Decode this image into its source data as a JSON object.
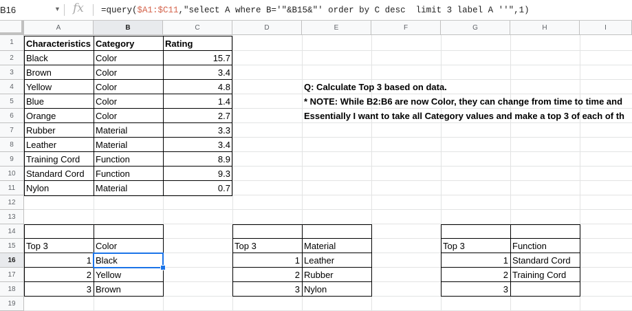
{
  "formula_bar": {
    "name_box": "B16",
    "fx": "fx",
    "formula_parts": [
      "=query(",
      "$A1:$C11",
      ",\"select A where B='\"&B15&\"' order by C desc  limit 3 label A ''\",1)"
    ]
  },
  "columns": [
    "A",
    "B",
    "C",
    "D",
    "E",
    "F",
    "G",
    "H",
    "I"
  ],
  "rows": [
    "1",
    "2",
    "3",
    "4",
    "5",
    "6",
    "7",
    "8",
    "9",
    "10",
    "11",
    "12",
    "13",
    "14",
    "15",
    "16",
    "17",
    "18",
    "19"
  ],
  "table": {
    "headers": [
      "Characteristics",
      "Category",
      "Rating"
    ],
    "rows": [
      [
        "Black",
        "Color",
        "15.7"
      ],
      [
        "Brown",
        "Color",
        "3.4"
      ],
      [
        "Yellow",
        "Color",
        "4.8"
      ],
      [
        "Blue",
        "Color",
        "1.4"
      ],
      [
        "Orange",
        "Color",
        "2.7"
      ],
      [
        "Rubber",
        "Material",
        "3.3"
      ],
      [
        "Leather",
        "Material",
        "3.4"
      ],
      [
        "Training Cord",
        "Function",
        "8.9"
      ],
      [
        "Standard Cord",
        "Function",
        "9.3"
      ],
      [
        "Nylon",
        "Material",
        "0.7"
      ]
    ]
  },
  "notes": [
    "Q: Calculate Top 3 based on data.",
    "* NOTE: While B2:B6 are now Color, they can change from time to time and",
    "Essentially I want to take all Category values and make a top 3 of each of th"
  ],
  "top3_blocks": [
    {
      "label": "Top 3",
      "category": "Color",
      "ranks": [
        "1",
        "2",
        "3"
      ],
      "values": [
        "Black",
        "Yellow",
        "Brown"
      ]
    },
    {
      "label": "Top 3",
      "category": "Material",
      "ranks": [
        "1",
        "2",
        "3"
      ],
      "values": [
        "Leather",
        "Rubber",
        "Nylon"
      ]
    },
    {
      "label": "Top 3",
      "category": "Function",
      "ranks": [
        "1",
        "2",
        "3"
      ],
      "values": [
        "Standard Cord",
        "Training Cord",
        ""
      ]
    }
  ]
}
